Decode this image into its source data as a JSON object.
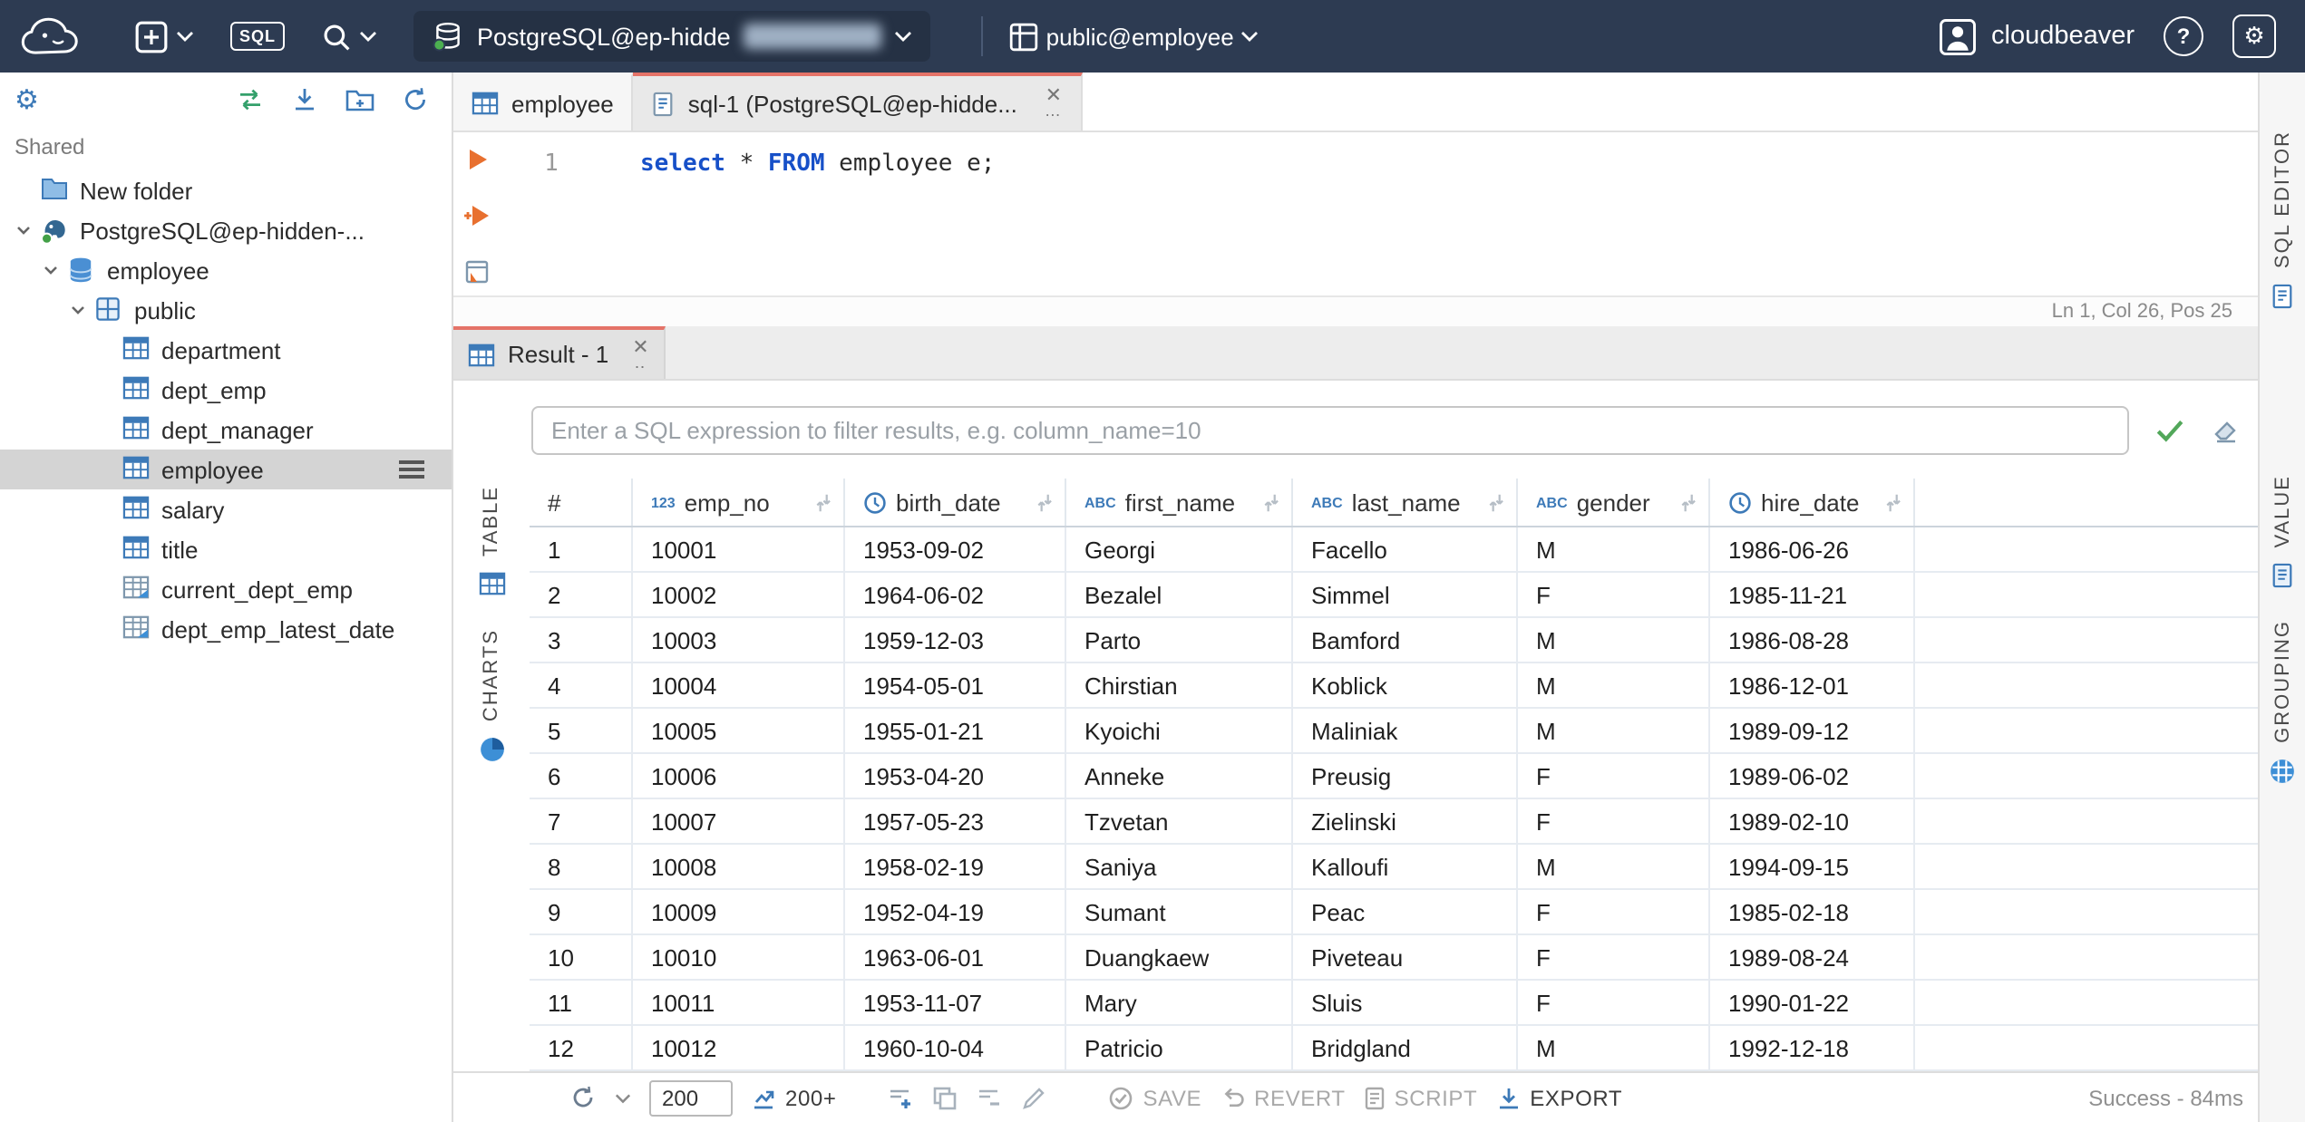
{
  "topbar": {
    "sql_button": "SQL",
    "connection": {
      "label": "PostgreSQL@ep-hidde"
    },
    "schema": {
      "label": "public@employee"
    },
    "user": {
      "label": "cloudbeaver"
    },
    "help_label": "?"
  },
  "sidebar": {
    "section": "Shared",
    "tree": [
      {
        "label": "New folder",
        "type": "folder",
        "indent": 1,
        "expanded": false,
        "selected": false
      },
      {
        "label": "PostgreSQL@ep-hidden-...",
        "type": "connection",
        "indent": 1,
        "expanded": true,
        "selected": false
      },
      {
        "label": "employee",
        "type": "database",
        "indent": 2,
        "expanded": true,
        "selected": false
      },
      {
        "label": "public",
        "type": "schema",
        "indent": 3,
        "expanded": true,
        "selected": false
      },
      {
        "label": "department",
        "type": "table",
        "indent": 4,
        "expanded": false,
        "selected": false
      },
      {
        "label": "dept_emp",
        "type": "table",
        "indent": 4,
        "expanded": false,
        "selected": false
      },
      {
        "label": "dept_manager",
        "type": "table",
        "indent": 4,
        "expanded": false,
        "selected": false
      },
      {
        "label": "employee",
        "type": "table",
        "indent": 4,
        "expanded": false,
        "selected": true
      },
      {
        "label": "salary",
        "type": "table",
        "indent": 4,
        "expanded": false,
        "selected": false
      },
      {
        "label": "title",
        "type": "table",
        "indent": 4,
        "expanded": false,
        "selected": false
      },
      {
        "label": "current_dept_emp",
        "type": "view",
        "indent": 4,
        "expanded": false,
        "selected": false
      },
      {
        "label": "dept_emp_latest_date",
        "type": "view",
        "indent": 4,
        "expanded": false,
        "selected": false
      }
    ]
  },
  "tabs": {
    "editor": [
      {
        "label": "employee"
      },
      {
        "label": "sql-1 (PostgreSQL@ep-hidde..."
      }
    ]
  },
  "editor": {
    "line_number": "1",
    "tokens": [
      {
        "t": "select",
        "c": "kw"
      },
      {
        "t": " * ",
        "c": "pl"
      },
      {
        "t": "FROM",
        "c": "kw"
      },
      {
        "t": " employee e;",
        "c": "pl"
      }
    ],
    "status": "Ln 1, Col 26, Pos 25",
    "side_tab": "SQL EDITOR"
  },
  "result": {
    "tab": "Result - 1",
    "filter_placeholder": "Enter a SQL expression to filter results, e.g. column_name=10",
    "left_tabs": [
      {
        "label": "TABLE"
      },
      {
        "label": "CHARTS"
      }
    ],
    "right_tabs": [
      {
        "label": "VALUE"
      },
      {
        "label": "GROUPING"
      }
    ],
    "grid": {
      "columns": [
        {
          "label": "#",
          "type": "index"
        },
        {
          "label": "emp_no",
          "type": "number"
        },
        {
          "label": "birth_date",
          "type": "datetime"
        },
        {
          "label": "first_name",
          "type": "string"
        },
        {
          "label": "last_name",
          "type": "string"
        },
        {
          "label": "gender",
          "type": "string"
        },
        {
          "label": "hire_date",
          "type": "datetime"
        }
      ],
      "rows": [
        [
          "1",
          "10001",
          "1953-09-02",
          "Georgi",
          "Facello",
          "M",
          "1986-06-26"
        ],
        [
          "2",
          "10002",
          "1964-06-02",
          "Bezalel",
          "Simmel",
          "F",
          "1985-11-21"
        ],
        [
          "3",
          "10003",
          "1959-12-03",
          "Parto",
          "Bamford",
          "M",
          "1986-08-28"
        ],
        [
          "4",
          "10004",
          "1954-05-01",
          "Chirstian",
          "Koblick",
          "M",
          "1986-12-01"
        ],
        [
          "5",
          "10005",
          "1955-01-21",
          "Kyoichi",
          "Maliniak",
          "M",
          "1989-09-12"
        ],
        [
          "6",
          "10006",
          "1953-04-20",
          "Anneke",
          "Preusig",
          "F",
          "1989-06-02"
        ],
        [
          "7",
          "10007",
          "1957-05-23",
          "Tzvetan",
          "Zielinski",
          "F",
          "1989-02-10"
        ],
        [
          "8",
          "10008",
          "1958-02-19",
          "Saniya",
          "Kalloufi",
          "M",
          "1994-09-15"
        ],
        [
          "9",
          "10009",
          "1952-04-19",
          "Sumant",
          "Peac",
          "F",
          "1985-02-18"
        ],
        [
          "10",
          "10010",
          "1963-06-01",
          "Duangkaew",
          "Piveteau",
          "F",
          "1989-08-24"
        ],
        [
          "11",
          "10011",
          "1953-11-07",
          "Mary",
          "Sluis",
          "F",
          "1990-01-22"
        ],
        [
          "12",
          "10012",
          "1960-10-04",
          "Patricio",
          "Bridgland",
          "M",
          "1992-12-18"
        ]
      ]
    }
  },
  "statusbar": {
    "rows_value": "200",
    "fetch_label": "200+",
    "save": "SAVE",
    "revert": "REVERT",
    "script": "SCRIPT",
    "export": "EXPORT",
    "status": "Success - 84ms"
  }
}
